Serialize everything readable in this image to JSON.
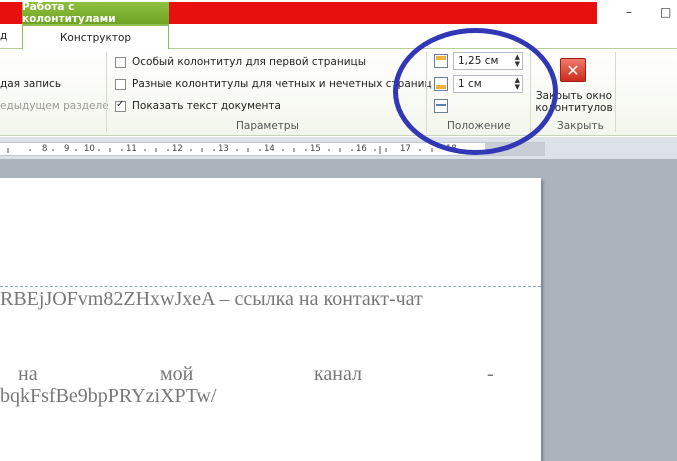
{
  "title_bar": {
    "context_tab_header": "Работа с колонтитулами",
    "minimize_glyph": "–",
    "restore_glyph": "□"
  },
  "tabs": {
    "left_partial": "д",
    "active": "Конструктор"
  },
  "ribbon": {
    "left_group": {
      "item1": "дая запись",
      "item2": "едыдущем разделе"
    },
    "params": {
      "first_page": "Особый колонтитул для первой страницы",
      "odd_even": "Разные колонтитулы для четных и нечетных страниц",
      "show_text": "Показать текст документа",
      "group_label": "Параметры",
      "first_page_checked": false,
      "odd_even_checked": false,
      "show_text_checked": true
    },
    "position": {
      "header_from_top": "1,25 см",
      "footer_from_bottom": "1 см",
      "group_label": "Положение"
    },
    "close": {
      "label": "Закрыть окно колонтитулов",
      "group_label": "Закрыть",
      "icon": "close-x-icon"
    }
  },
  "ruler": {
    "numbers": [
      "8",
      "9",
      "10",
      "11",
      "12",
      "13",
      "14",
      "15",
      "16",
      "17",
      "18"
    ]
  },
  "document": {
    "line1": "RBEjJOFvm82ZHxwJxeA – ссылка на контакт-чат",
    "line2_word1": "на",
    "line2_word2": "мой",
    "line2_word3": "канал",
    "line2_word4": "-",
    "line3": "bqkFsfBe9bpPRYziXPTw/"
  },
  "annotation": {
    "color": "#3137b5"
  }
}
